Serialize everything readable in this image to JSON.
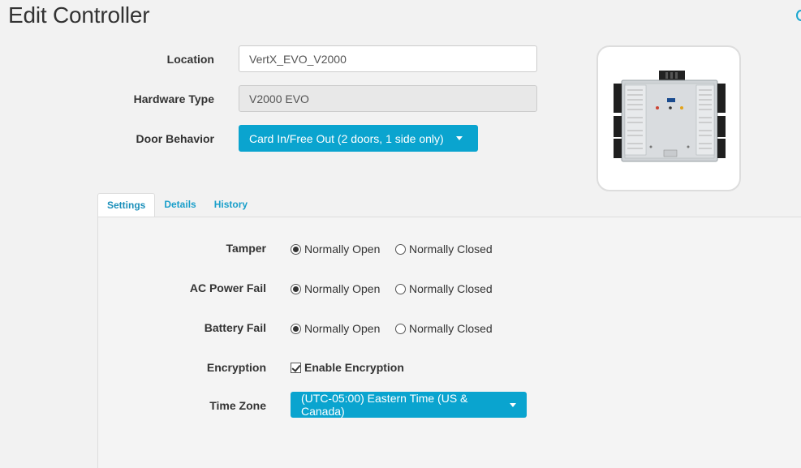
{
  "page": {
    "title": "Edit Controller"
  },
  "form": {
    "location": {
      "label": "Location",
      "value": "VertX_EVO_V2000"
    },
    "hardware_type": {
      "label": "Hardware Type",
      "value": "V2000 EVO"
    },
    "door_behavior": {
      "label": "Door Behavior",
      "value": "Card In/Free Out (2 doors, 1 side only)"
    }
  },
  "device_image": {
    "name": "controller-board-image"
  },
  "tabs": [
    {
      "label": "Settings",
      "active": true
    },
    {
      "label": "Details",
      "active": false
    },
    {
      "label": "History",
      "active": false
    }
  ],
  "settings": {
    "tamper": {
      "label": "Tamper",
      "options": [
        "Normally Open",
        "Normally Closed"
      ],
      "selected": "Normally Open"
    },
    "ac_power_fail": {
      "label": "AC Power Fail",
      "options": [
        "Normally Open",
        "Normally Closed"
      ],
      "selected": "Normally Open"
    },
    "battery_fail": {
      "label": "Battery Fail",
      "options": [
        "Normally Open",
        "Normally Closed"
      ],
      "selected": "Normally Open"
    },
    "encryption": {
      "label": "Encryption",
      "checkbox_label": "Enable Encryption",
      "checked": true
    },
    "time_zone": {
      "label": "Time Zone",
      "value": "(UTC-05:00) Eastern Time (US & Canada)"
    }
  },
  "colors": {
    "accent": "#0aa4cf",
    "tab_text": "#1a9fca"
  }
}
